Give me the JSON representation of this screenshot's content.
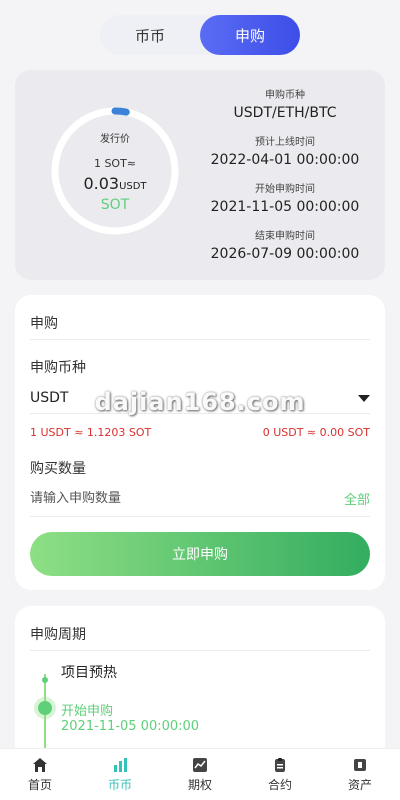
{
  "tabs": [
    {
      "label": "币币",
      "active": false
    },
    {
      "label": "申购",
      "active": true
    }
  ],
  "info": {
    "ring_label": "发行价",
    "rate_line": "1 SOT≈",
    "rate_value": "0.03",
    "rate_unit": "USDT",
    "token": "SOT",
    "progress_fraction": 0.03,
    "currency_key": "申购币种",
    "currency_val": "USDT/ETH/BTC",
    "listing_key": "预计上线时间",
    "listing_val": "2022-04-01 00:00:00",
    "start_key": "开始申购时间",
    "start_val": "2021-11-05 00:00:00",
    "end_key": "结束申购时间",
    "end_val": "2026-07-09 00:00:00"
  },
  "buy": {
    "title": "申购",
    "currency_label": "申购币种",
    "selected_currency": "USDT",
    "rate_left": "1 USDT ≈ 1.1203 SOT",
    "rate_right": "0 USDT ≈ 0.00 SOT",
    "qty_label": "购买数量",
    "qty_placeholder": "请输入申购数量",
    "all_label": "全部",
    "submit_label": "立即申购"
  },
  "cycle": {
    "title": "申购周期",
    "step1": "项目预热",
    "step2": "开始申购",
    "step2_time": "2021-11-05 00:00:00"
  },
  "watermark": "dajian168.com",
  "nav": [
    {
      "label": "首页",
      "icon": "home-icon",
      "active": false
    },
    {
      "label": "币币",
      "icon": "bar-chart-icon",
      "active": true
    },
    {
      "label": "期权",
      "icon": "trend-chart-icon",
      "active": false
    },
    {
      "label": "合约",
      "icon": "clipboard-icon",
      "active": false
    },
    {
      "label": "资产",
      "icon": "wallet-icon",
      "active": false
    }
  ],
  "colors": {
    "accent_blue": "#4a5cf0",
    "accent_green": "#5fcf7a",
    "danger": "#d9302c",
    "nav_active": "#35c1b9"
  }
}
